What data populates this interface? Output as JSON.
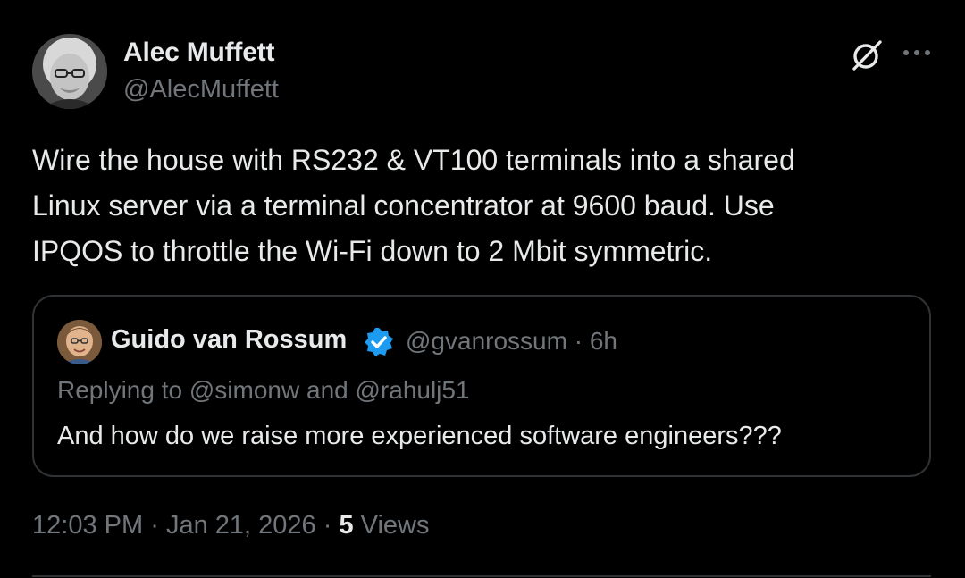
{
  "tweet": {
    "author": {
      "name": "Alec Muffett",
      "handle": "@AlecMuffett"
    },
    "text_lines": [
      "Wire the house with RS232 & VT100 terminals into a shared",
      "Linux server via a terminal concentrator at 9600 baud. Use",
      "IPQOS to throttle the Wi-Fi down to 2 Mbit symmetric."
    ],
    "quoted": {
      "name": "Guido van Rossum",
      "handle": "@gvanrossum",
      "separator": "·",
      "age": "6h",
      "replying_prefix": "Replying to ",
      "mention1": "@simonw",
      "and_word": " and ",
      "mention2": "@rahulj51",
      "text": "And how do we raise more experienced software engineers???"
    },
    "meta": {
      "time": "12:03 PM",
      "separator": "·",
      "date": "Jan 21, 2026",
      "views_count": "5",
      "views_label": "Views"
    }
  },
  "icons": {
    "grok": "grok-icon",
    "more": "more-icon",
    "verified": "verified-badge-icon"
  },
  "colors": {
    "background": "#000000",
    "text_primary": "#e7e9ea",
    "text_secondary": "#71767b",
    "border": "#2f3336",
    "verified_blue": "#1d9bf0"
  }
}
